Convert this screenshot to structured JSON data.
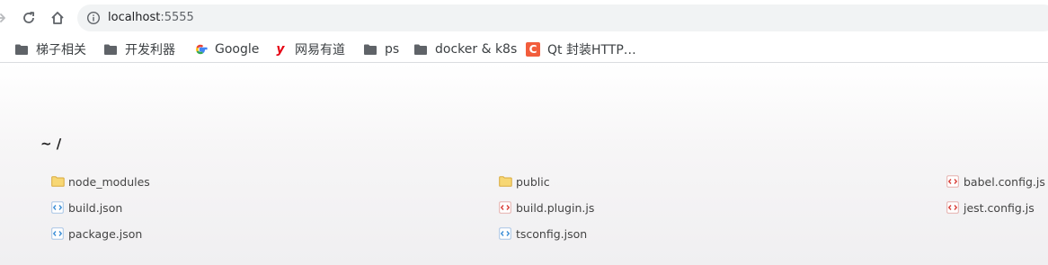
{
  "browser": {
    "url_host": "localhost",
    "url_port": ":5555"
  },
  "bookmarks": [
    {
      "label": "梯子相关",
      "icon": "folder-icon"
    },
    {
      "label": "开发利器",
      "icon": "folder-icon"
    },
    {
      "label": "Google",
      "icon": "google-icon"
    },
    {
      "label": "网易有道",
      "icon": "youdao-icon",
      "icon_letter": "y"
    },
    {
      "label": "ps",
      "icon": "folder-icon"
    },
    {
      "label": "docker & k8s",
      "icon": "folder-icon"
    },
    {
      "label": "Qt 封装HTTP…",
      "icon": "csdn-icon",
      "icon_letter": "C"
    }
  ],
  "page": {
    "heading": "~ /",
    "files": [
      {
        "name": "node_modules",
        "type": "folder",
        "icon": "folder-icon"
      },
      {
        "name": "public",
        "type": "folder",
        "icon": "folder-icon"
      },
      {
        "name": "babel.config.js",
        "type": "js",
        "icon": "code-file-icon"
      },
      {
        "name": "build.json",
        "type": "json",
        "icon": "json-file-icon"
      },
      {
        "name": "build.plugin.js",
        "type": "js",
        "icon": "code-file-icon"
      },
      {
        "name": "jest.config.js",
        "type": "js",
        "icon": "code-file-icon"
      },
      {
        "name": "package.json",
        "type": "json",
        "icon": "json-file-icon"
      },
      {
        "name": "tsconfig.json",
        "type": "json",
        "icon": "json-file-icon"
      }
    ]
  },
  "colors": {
    "folder_fill": "#f7d774",
    "folder_stroke": "#d9a93a",
    "json_accent": "#3d8fd6",
    "js_accent": "#d9403a",
    "youdao_red": "#e60012",
    "csdn_red": "#f25d3c"
  }
}
